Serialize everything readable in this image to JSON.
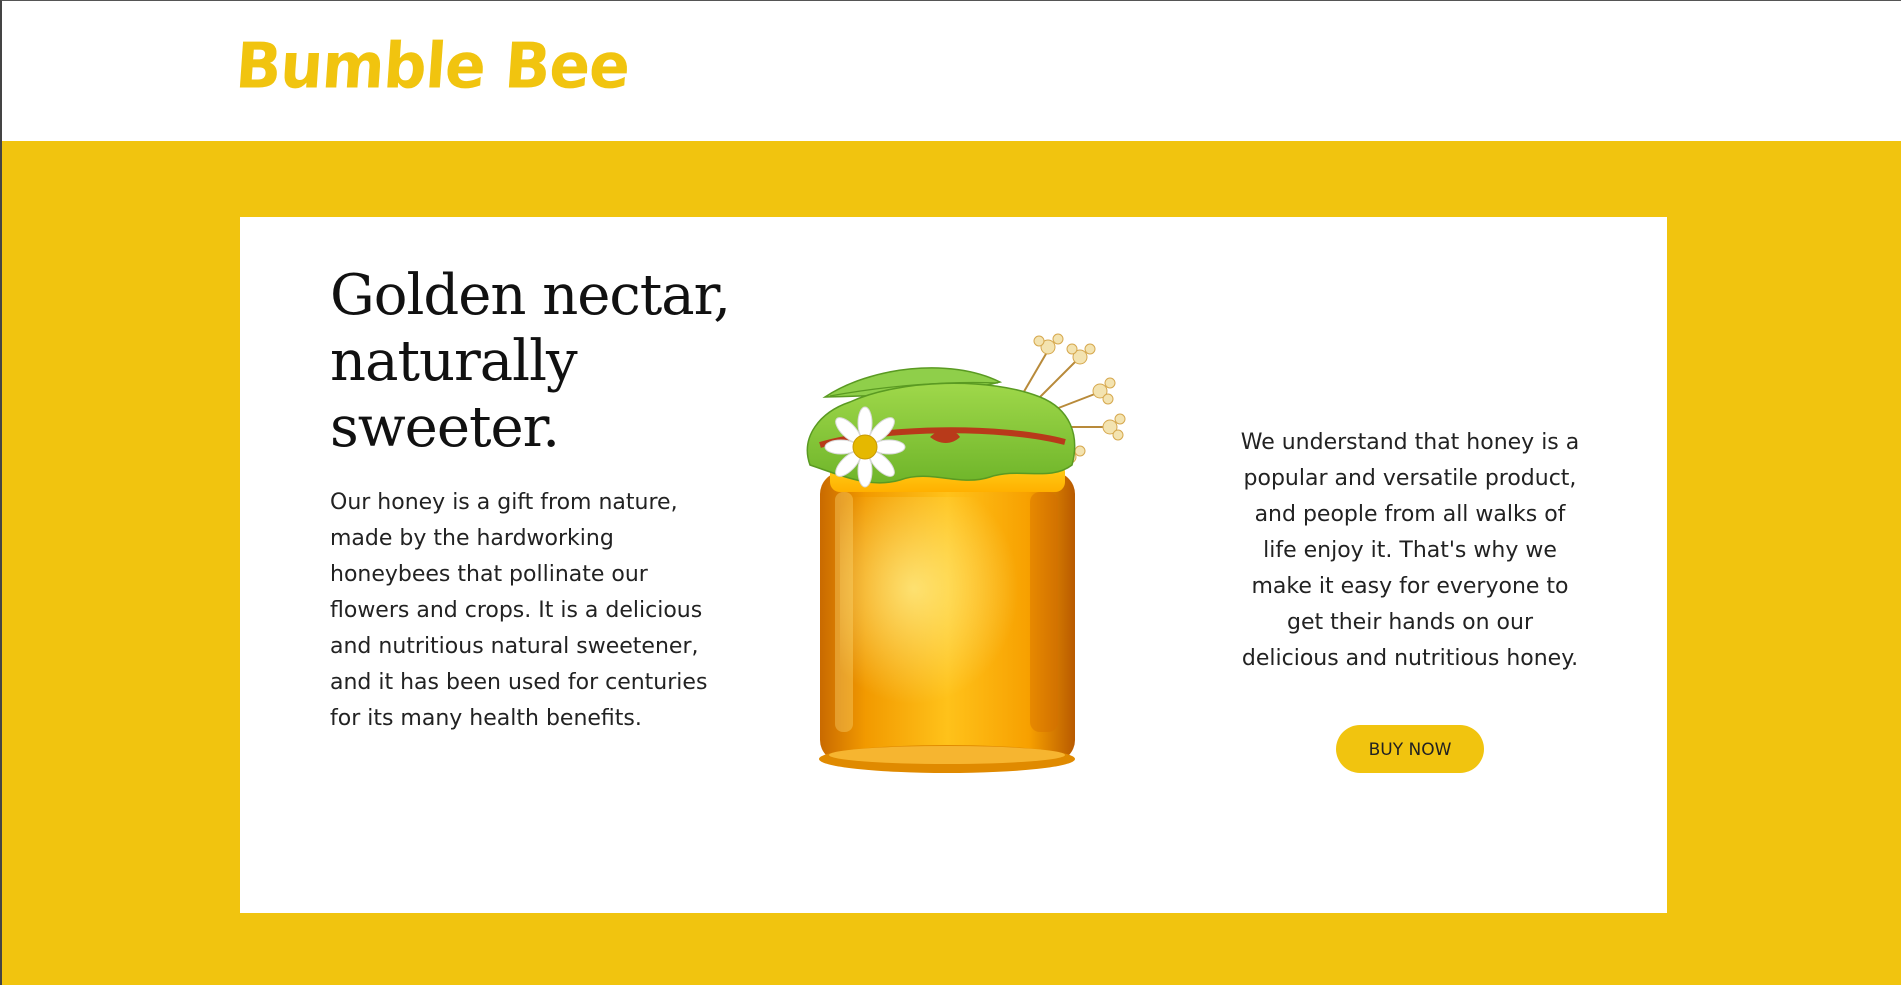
{
  "header": {
    "logo_text": "Bumble Bee"
  },
  "hero": {
    "headline": "Golden nectar, naturally sweeter.",
    "intro": "Our honey is a gift from nature, made by the hardworking honeybees that pollinate our flowers and crops. It is a delicious and nutritious natural sweetener, and it has been used for centuries for its many health benefits.",
    "secondary": "We understand that honey is a popular and versatile product, and people from all walks of life enjoy it. That's why we make it easy for everyone to get their hands on our delicious and nutritious honey.",
    "cta_label": "BUY NOW",
    "image_icon": "honey-jar-image"
  },
  "colors": {
    "brand_yellow": "#f1c40f",
    "card_background": "#ffffff",
    "text": "#222222",
    "headline_text": "#111111"
  }
}
